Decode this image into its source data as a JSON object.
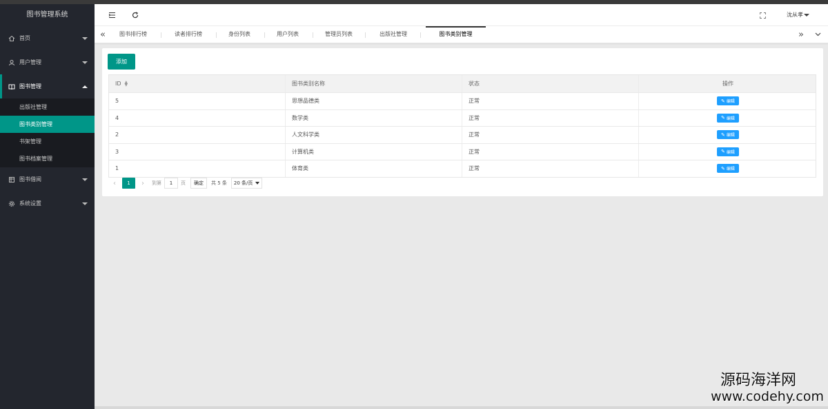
{
  "app": {
    "title": "图书管理系统"
  },
  "sidebar": {
    "items": [
      {
        "label": "首页",
        "icon": "home-icon"
      },
      {
        "label": "用户管理",
        "icon": "user-icon"
      },
      {
        "label": "图书管理",
        "icon": "book-icon"
      },
      {
        "label": "图书借阅",
        "icon": "borrow-icon"
      },
      {
        "label": "系统设置",
        "icon": "gear-icon"
      }
    ],
    "submenu": [
      "出版社管理",
      "图书类别管理",
      "书架管理",
      "图书档案管理"
    ]
  },
  "header": {
    "user": "沈从孝"
  },
  "tabs": [
    "图书排行榜",
    "读者排行榜",
    "身份列表",
    "用户列表",
    "管理员列表",
    "出版社管理",
    "图书类别管理"
  ],
  "toolbar": {
    "add_label": "添加"
  },
  "table": {
    "columns": [
      "ID",
      "图书类别名称",
      "状态",
      "操作"
    ],
    "rows": [
      {
        "id": "5",
        "name": "思想品德类",
        "status": "正常",
        "action": "编辑"
      },
      {
        "id": "4",
        "name": "数学类",
        "status": "正常",
        "action": "编辑"
      },
      {
        "id": "2",
        "name": "人文科学类",
        "status": "正常",
        "action": "编辑"
      },
      {
        "id": "3",
        "name": "计算机类",
        "status": "正常",
        "action": "编辑"
      },
      {
        "id": "1",
        "name": "体育类",
        "status": "正常",
        "action": "编辑"
      }
    ]
  },
  "pagination": {
    "current_page": "1",
    "goto_label": "到第",
    "goto_value": "1",
    "page_unit": "页",
    "confirm_label": "确定",
    "total_label": "共 5 条",
    "page_size": "20 条/页"
  },
  "watermark": {
    "line1": "源码海洋网",
    "line2": "www.codehy.com"
  },
  "colors": {
    "accent": "#009688",
    "sidebar_bg": "#23262e",
    "edit_button": "#1e9fff"
  }
}
